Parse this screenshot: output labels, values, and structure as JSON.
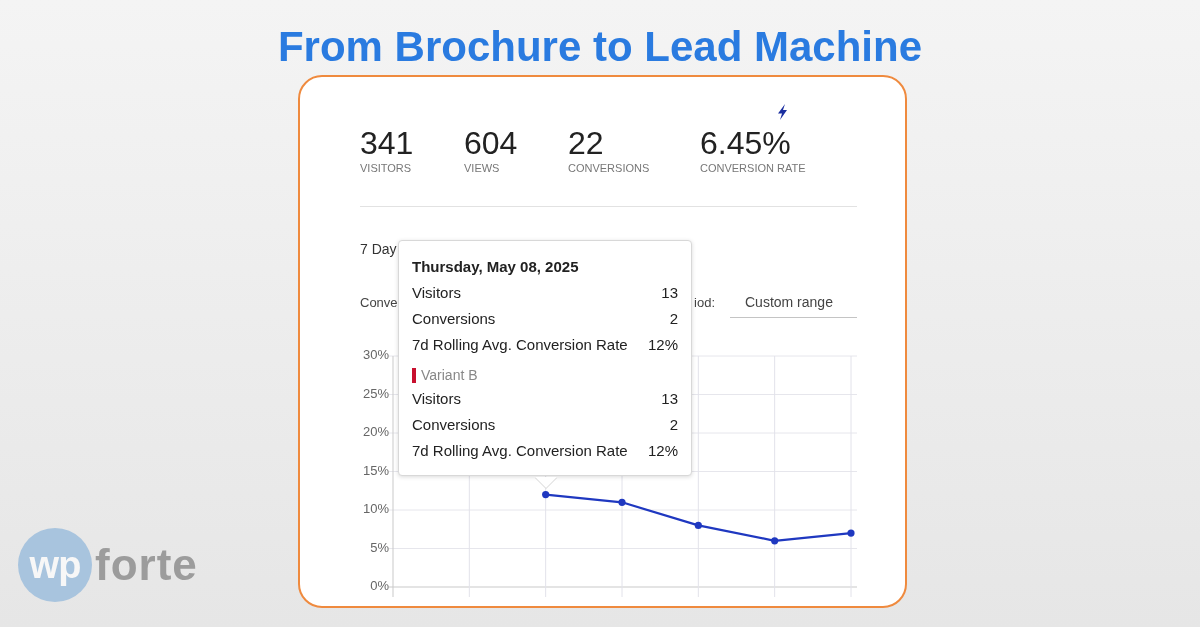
{
  "headline": "From Brochure to Lead Machine",
  "card": {
    "stats": [
      {
        "value": "341",
        "label": "VISITORS"
      },
      {
        "value": "604",
        "label": "VIEWS"
      },
      {
        "value": "22",
        "label": "CONVERSIONS"
      },
      {
        "value": "6.45%",
        "label": "CONVERSION RATE"
      }
    ],
    "section_title": "7 Day",
    "chart_label": "Conve",
    "period": {
      "label": "iod:",
      "field": {
        "value": "Custom range"
      }
    },
    "chart_data": [
      {
        "type": "line",
        "categories": [
          null,
          null,
          null,
          null,
          null,
          null,
          null
        ],
        "values": [
          null,
          null,
          12,
          11,
          8,
          6,
          7
        ],
        "color": "#1f38c0",
        "ylim": [
          0,
          30
        ],
        "yticks": [
          {
            "value": 0,
            "label": "0%"
          },
          {
            "value": 5,
            "label": "5%"
          },
          {
            "value": 10,
            "label": "10%"
          },
          {
            "value": 15,
            "label": "15%"
          },
          {
            "value": 20,
            "label": "20%"
          },
          {
            "value": 25,
            "label": "25%"
          },
          {
            "value": 30,
            "label": "30%"
          }
        ],
        "tick_labels": "y",
        "grid": true,
        "marker": "circle"
      }
    ],
    "tooltip": {
      "title": "Thursday, May 08, 2025",
      "groups": [
        {
          "rows": [
            {
              "label": "Visitors",
              "value": "13"
            },
            {
              "label": "Conversions",
              "value": "2"
            },
            {
              "label": "7d Rolling Avg. Conversion Rate",
              "value": "12%"
            }
          ]
        },
        {
          "name": "Variant B",
          "color": "#c8102e",
          "rows": [
            {
              "label": "Visitors",
              "value": "13"
            },
            {
              "label": "Conversions",
              "value": "2"
            },
            {
              "label": "7d Rolling Avg. Conversion Rate",
              "value": "12%"
            }
          ]
        }
      ]
    }
  },
  "logo": {
    "mark": "wp",
    "word": "forte"
  }
}
